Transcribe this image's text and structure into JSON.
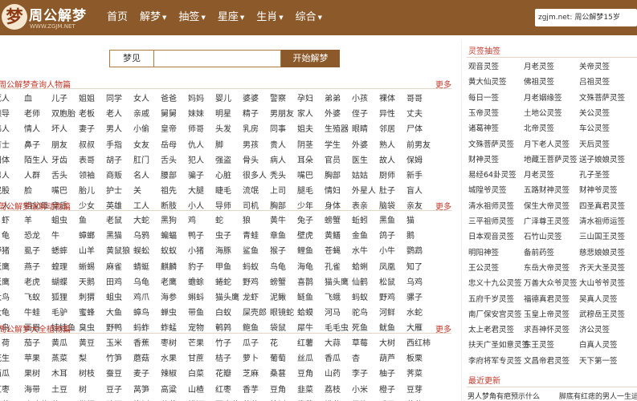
{
  "logo": {
    "mark": "梦",
    "name": "周公解梦",
    "url": "WWW.ZGJM.NET"
  },
  "nav": [
    {
      "label": "首页",
      "caret": ""
    },
    {
      "label": "解梦",
      "caret": "▼"
    },
    {
      "label": "抽签",
      "caret": "▼"
    },
    {
      "label": "星座",
      "caret": "▼"
    },
    {
      "label": "生肖",
      "caret": "▼"
    },
    {
      "label": "综合",
      "caret": "▼"
    }
  ],
  "header_search": {
    "prefix": "zgjm.net:",
    "text": "周公解梦15岁"
  },
  "dream_search": {
    "label": "梦见",
    "placeholder": "",
    "button": "开始解梦"
  },
  "sections": [
    {
      "title": "周公解梦查询人物篇",
      "more": "更多",
      "rows": [
        [
          "死人",
          "血",
          "儿子",
          "姐姐",
          "同学",
          "女人",
          "爸爸",
          "妈妈",
          "婴儿",
          "婆婆",
          "警察",
          "孕妇",
          "弟弟",
          "小孩",
          "裸体",
          "哥哥"
        ],
        [
          "领导",
          "老师",
          "双胞胎",
          "老板",
          "老人",
          "亲戚",
          "舅舅",
          "妹妹",
          "明星",
          "精子",
          "男朋友",
          "家人",
          "外婆",
          "侄子",
          "异性",
          "丈夫"
        ],
        [
          "伟人",
          "情人",
          "坏人",
          "妻子",
          "男人",
          "小偷",
          "皇帝",
          "师哥",
          "头发",
          "乳房",
          "同事",
          "姐夫",
          "生殖器",
          "眼睛",
          "邻居",
          "尸体"
        ],
        [
          "首士",
          "鼻子",
          "朋友",
          "叔叔",
          "手指",
          "女友",
          "岳母",
          "仇人",
          "脚",
          "男孩",
          "贵人",
          "阴茎",
          "学生",
          "外婆",
          "熟人",
          "前男友"
        ],
        [
          "阳体",
          "陌生人",
          "牙齿",
          "表哥",
          "胡子",
          "肛门",
          "舌头",
          "犯人",
          "强盗",
          "骨头",
          "病人",
          "耳朵",
          "官员",
          "医生",
          "故人",
          "保姆"
        ],
        [
          "男人",
          "人群",
          "舌头",
          "领袖",
          "商贩",
          "名人",
          "腰部",
          "骗子",
          "心脏",
          "很多人",
          "秃头",
          "嘴巴",
          "胸部",
          "姑姑",
          "厨师",
          "新手"
        ],
        [
          "屁股",
          "脸",
          "嘴巴",
          "胎儿",
          "护士",
          "关",
          "祖先",
          "大腿",
          "睫毛",
          "流氓",
          "上司",
          "腿毛",
          "情妇",
          "外星人",
          "肚子",
          "盲人"
        ],
        [
          "五人",
          "祖父母",
          "皇后",
          "少女",
          "英雄",
          "工人",
          "断肢",
          "小人",
          "导师",
          "司机",
          "胸部",
          "少年",
          "身体",
          "表亲",
          "脑袋",
          "亲友"
        ]
      ]
    },
    {
      "title": "周公解梦破解动物篇",
      "more": "更多",
      "rows": [
        [
          "虾",
          "羊",
          "蛆虫",
          "鱼",
          "老鼠",
          "大蛇",
          "黑狗",
          "鸡",
          "蛇",
          "狼",
          "黄牛",
          "兔子",
          "螃蟹",
          "蚯蚓",
          "黑鱼",
          "猫"
        ],
        [
          "龟",
          "恐龙",
          "牛",
          "蟑螂",
          "黑猫",
          "乌鸦",
          "蝙蝠",
          "鸭子",
          "虫子",
          "青蛙",
          "章鱼",
          "壁虎",
          "黄鳝",
          "金鱼",
          "鸽子",
          "鹅"
        ],
        [
          "野猪",
          "虱子",
          "蟋蟀",
          "山羊",
          "黄鼠狼",
          "蜈蚣",
          "蚁蚁",
          "小猪",
          "海豚",
          "鲨鱼",
          "猴子",
          "鲤鱼",
          "苍蝇",
          "水牛",
          "小牛",
          "鹦鹉"
        ],
        [
          "老鹰",
          "燕子",
          "蝗理",
          "蜥蜴",
          "麻雀",
          "蜻蜓",
          "麒麟",
          "豹子",
          "甲鱼",
          "蚂蚁",
          "鸟龟",
          "海龟",
          "孔雀",
          "蛤蜊",
          "凤凰",
          "知了"
        ],
        [
          "老鹰",
          "老虎",
          "蝴蝶",
          "天鹅",
          "田鸡",
          "乌龟",
          "老鹰",
          "蟾蜍",
          "蜷蛇",
          "野鸡",
          "螃蟹",
          "喜鹊",
          "猫头鹰",
          "仙鹤",
          "松鼠",
          "乌鸡"
        ],
        [
          "大鸟",
          "飞蚁",
          "狐狸",
          "刺猬",
          "蛆虫",
          "鸡爪",
          "海参",
          "蝌蚪",
          "猫头鹰",
          "龙虾",
          "泥鳅",
          "鲢鱼",
          "飞蛾",
          "蚂蚁",
          "野鸡",
          "骡子"
        ],
        [
          "大龟",
          "牛蛙",
          "毛驴",
          "蜜蜂",
          "大鱼",
          "蟑鸟",
          "蝉虫",
          "带鱼",
          "白蚁",
          "屎壳郎",
          "眼镜蛇",
          "蛤蟆",
          "河马",
          "驼鸟",
          "河鲜",
          "水蛇"
        ],
        [
          "小鸟",
          "画眉",
          "娃娃鱼",
          "臭虫",
          "野鸭",
          "蚂蚱",
          "蚱蜢",
          "宠物",
          "鹌鹑",
          "鲍鱼",
          "袋鼠",
          "犀牛",
          "毛毛虫",
          "死鱼",
          "鱿鱼",
          "大雁"
        ]
      ]
    },
    {
      "title": "周公解梦大全植物篇",
      "more": "更多",
      "rows": [
        [
          "荷",
          "茄子",
          "黄瓜",
          "黄豆",
          "玉米",
          "香蕉",
          "枣树",
          "芒果",
          "竹子",
          "瓜子",
          "花",
          "红薯",
          "大蒜",
          "草莓",
          "大树",
          "西红柿"
        ],
        [
          "花生",
          "苹果",
          "蒸菜",
          "梨",
          "竹笋",
          "蘑菇",
          "水果",
          "甘蔗",
          "桔子",
          "萝卜",
          "葡萄",
          "丝瓜",
          "香瓜",
          "杏",
          "葫芦",
          "板栗"
        ],
        [
          "西瓜",
          "果树",
          "木耳",
          "树枝",
          "蚕豆",
          "麦子",
          "辣椒",
          "白菜",
          "花瓣",
          "芝麻",
          "桑葚",
          "豆角",
          "山药",
          "李子",
          "柚子",
          "荠菜"
        ],
        [
          "红枣",
          "海带",
          "土豆",
          "树",
          "豆子",
          "莴笋",
          "高粱",
          "山楂",
          "红枣",
          "香芋",
          "豆角",
          "韭菜",
          "荔枝",
          "小米",
          "橙子",
          "豆芽"
        ],
        [
          "荷",
          "玫瑰花",
          "草",
          "枇杷",
          "豌豆",
          "柳树",
          "菩萨",
          "桃源",
          "百合花",
          "芹菜",
          "柏树",
          "榴莲",
          "桃花",
          "杨梅",
          "瓜果",
          "荷花"
        ]
      ]
    }
  ],
  "sidebar": {
    "title": "灵签抽签",
    "rows": [
      [
        "观音灵签",
        "月老灵签",
        "关帝灵签"
      ],
      [
        "黄大仙灵签",
        "佛祖灵签",
        "吕祖灵签"
      ],
      [
        "每日一签",
        "月老姻缘签",
        "文殊菩萨灵签"
      ],
      [
        "玉帝灵签",
        "土地公灵签",
        "关公灵签"
      ],
      [
        "诸葛神签",
        "北帝灵签",
        "车公灵签"
      ],
      [
        "文殊菩萨灵签",
        "月下老人灵签",
        "天后灵签"
      ],
      [
        "财神灵签",
        "地藏王菩萨灵签",
        "送子娘娘灵签"
      ],
      [
        "易经64卦灵签",
        "月老灵签",
        "孔子圣签"
      ],
      [
        "城隍爷灵签",
        "五路财神灵签",
        "财神爷灵签"
      ],
      [
        "清水祖师灵签",
        "保生大帝灵签",
        "四圣真君灵签"
      ],
      [
        "三平祖师灵签",
        "广泽尊王灵签",
        "清水祖师运签"
      ],
      [
        "日本观音灵签",
        "石竹山灵签",
        "三山国王灵签"
      ],
      [
        "明阳神签",
        "备前药签",
        "慈悲娘娘灵签"
      ],
      [
        "王公灵签",
        "东岳大帝灵签",
        "齐天大圣灵签"
      ],
      [
        "忠义十九公灵签",
        "万善大众爷灵签",
        "大山爷爷灵签"
      ],
      [
        "五府千岁灵签",
        "福德真君灵签",
        "吴真人灵签"
      ],
      [
        "南厂保安宫灵签",
        "玉皇上帝灵签",
        "武穆岳王灵签"
      ],
      [
        "太上老君灵签",
        "求吾神怀灵签",
        "济公灵签"
      ],
      [
        "扶天广圣如意灵签",
        "东王灵签",
        "白真人灵签"
      ],
      [
        "李府将军专灵签",
        "文昌帝君灵签",
        "天下第一签"
      ]
    ],
    "latest_title": "最近更新",
    "latest": [
      "男人梦角有疤预示什么",
      "脚底有红痣的男人一生运"
    ]
  }
}
